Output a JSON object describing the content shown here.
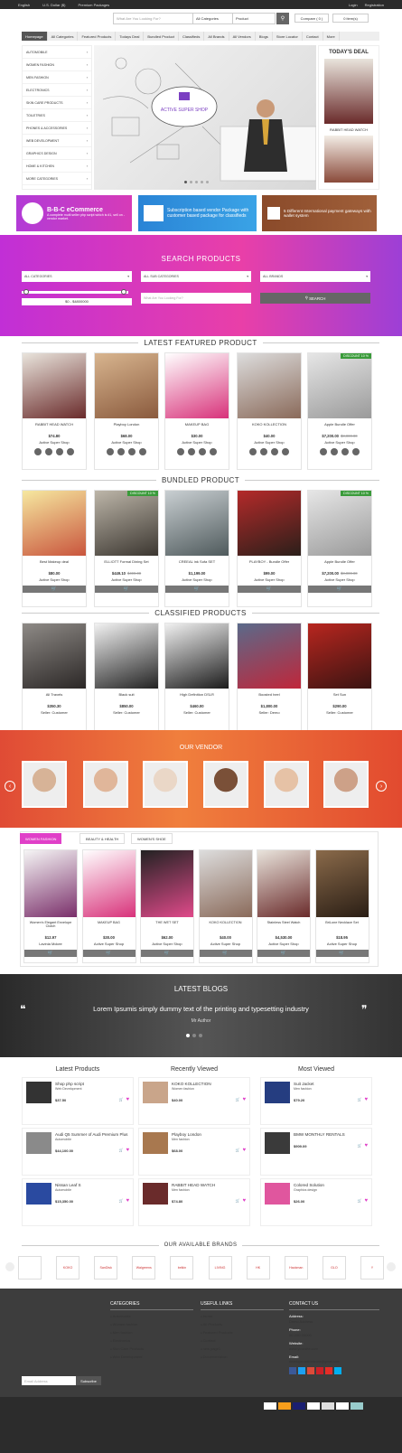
{
  "topbar": {
    "lang": "English",
    "currency": "U.S. Dollar ($)",
    "premium": "Premium Packages",
    "login": "Login",
    "register": "Registration"
  },
  "search": {
    "placeholder": "What Are You Looking For?",
    "category": "All Categories",
    "type": "Product",
    "compare": "Compare ( 0 )",
    "cart": "0 item(s)"
  },
  "nav": [
    "Homepage",
    "All Categories",
    "Featured Products",
    "Todays Deal",
    "Bundled Product",
    "Classifieds",
    "All Brands",
    "All Vendors",
    "Blogs",
    "Store Locator",
    "Contact",
    "More"
  ],
  "categories": [
    "AUTOMOBILE",
    "WOMEN FASHION",
    "MEN FASHION",
    "ELECTRONICS",
    "SKIN CARE PRODUCTS",
    "TOILETRIES",
    "PHONES & ACCESSORIES",
    "WEB DEVELOPMENT",
    "GRAPHICS DESIGN",
    "HOME & KITCHEN",
    "MORE CATEGORIES"
  ],
  "hero": {
    "sign": "ACTIVE SUPER SHOP"
  },
  "today": {
    "title": "TODAY'S DEAL",
    "item": "RABBIT HEAD WATCH"
  },
  "banners": {
    "b1title": "B-B-C eCommerce",
    "b1text": "A complete multi seller php script which is #1, sell on - vendor market.",
    "b2text": "Subscription based vendor Package with customer based package for classifieds",
    "b3text": "5 Different International payment gateways with wallet system"
  },
  "searchproducts": {
    "title": "SEARCH PRODUCTS",
    "cat": "ALL CATEGORIES",
    "sub": "ALL SUB CATEGORIES",
    "brand": "ALL BRANDS",
    "range": "$0 - $4800000",
    "placeholder": "What Are You Looking For?",
    "btn": "SEARCH"
  },
  "featured": {
    "title": "LATEST FEATURED PRODUCT",
    "items": [
      {
        "name": "RABBIT HEAD WATCH",
        "price": "$74.80",
        "old": "",
        "shop": "Active Super Shop",
        "disc": "",
        "c1": "#e9e4dc",
        "c2": "#6a2b2b"
      },
      {
        "name": "Playboy London",
        "price": "$68.00",
        "old": "",
        "shop": "Active Super Shop",
        "disc": "",
        "c1": "#d8b58f",
        "c2": "#8a5a3d"
      },
      {
        "name": "MAKEUP BAG",
        "price": "$30.00",
        "old": "",
        "shop": "Active Super Shop",
        "disc": "",
        "c1": "#fff",
        "c2": "#d8327a"
      },
      {
        "name": "KOKO KOLLECTION",
        "price": "$40.00",
        "old": "",
        "shop": "Active Super Shop",
        "disc": "",
        "c1": "#ddd",
        "c2": "#8a6a5a"
      },
      {
        "name": "Apple Bundle Offer",
        "price": "$7,200.00",
        "old": "$8,000.00",
        "shop": "Active Super Shop",
        "disc": "DISCOUNT 10 %",
        "c1": "#e6e6e6",
        "c2": "#9a9a9a"
      }
    ]
  },
  "bundled": {
    "title": "BUNDLED PRODUCT",
    "items": [
      {
        "name": "Best Makeup deal",
        "price": "$80.00",
        "old": "",
        "shop": "Active Super Shop",
        "disc": "",
        "c1": "#f6e8a0",
        "c2": "#c9553d"
      },
      {
        "name": "ELLIOTT Formal Dining Set",
        "price": "$449.10",
        "old": "$499.00",
        "shop": "Active Super Shop",
        "disc": "DISCOUNT 10 %",
        "c1": "#bdb6a9",
        "c2": "#3b3630"
      },
      {
        "name": "CREEAL ink Sofa SET",
        "price": "$1,199.00",
        "old": "",
        "shop": "Active Super Shop",
        "disc": "",
        "c1": "#c9cfd2",
        "c2": "#4f5a5c"
      },
      {
        "name": "PLAYBOY - Bundle Offer",
        "price": "$99.00",
        "old": "",
        "shop": "Active Super Shop",
        "disc": "",
        "c1": "#b42a2a",
        "c2": "#2b1f1a"
      },
      {
        "name": "Apple Bundle Offer",
        "price": "$7,200.00",
        "old": "$8,000.00",
        "shop": "Active Super Shop",
        "disc": "DISCOUNT 10 %",
        "c1": "#e6e6e6",
        "c2": "#9a9a9a"
      }
    ]
  },
  "classified": {
    "title": "CLASSIFIED PRODUCTS",
    "items": [
      {
        "name": "All Travels",
        "price": "$350.30",
        "shop": "Seller: Customer",
        "c1": "#8e8a86",
        "c2": "#2b2726"
      },
      {
        "name": "Black suit",
        "price": "$850.00",
        "shop": "Seller: Customer",
        "c1": "#f2f2f2",
        "c2": "#222"
      },
      {
        "name": "High Definition DSLR",
        "price": "$460.00",
        "shop": "Seller: Customer",
        "c1": "#f1f1f1",
        "c2": "#1b1b1b"
      },
      {
        "name": "Boosted heel",
        "price": "$1,800.00",
        "shop": "Seller: Demo",
        "c1": "#5a6a8a",
        "c2": "#c0263a"
      },
      {
        "name": "Set Sun",
        "price": "$290.00",
        "shop": "Seller: Customer",
        "c1": "#b8261f",
        "c2": "#3a1412"
      }
    ]
  },
  "vendor": {
    "title": "OUR VENDOR",
    "faces": [
      "#d7b397",
      "#e0b69a",
      "#ead7c7",
      "#7a5038",
      "#e6c2a6",
      "#cda188"
    ]
  },
  "tabs": {
    "labels": [
      "WOMEN FASHION",
      "BEAUTY & HEALTH",
      "WOMEN'S SHOE"
    ],
    "items": [
      {
        "name": "Women's Elegant Envelope Clutch",
        "price": "$12.97",
        "shop": "Lavinia Mckee",
        "c1": "#f5f5f5",
        "c2": "#7a2f6a"
      },
      {
        "name": "MAKEUP BAG",
        "price": "$30.00",
        "shop": "Active Super Shop",
        "c1": "#fff",
        "c2": "#d8327a"
      },
      {
        "name": "THE WET SET",
        "price": "$62.00",
        "shop": "Active Super Shop",
        "c1": "#222",
        "c2": "#e04a8a"
      },
      {
        "name": "KOKO KOLLECTION",
        "price": "$40.00",
        "shop": "Active Super Shop",
        "c1": "#ddd",
        "c2": "#8a6a5a"
      },
      {
        "name": "Stainless Steel Watch",
        "price": "$4,530.00",
        "shop": "Active Super Shop",
        "c1": "#e9e4dc",
        "c2": "#6a2b2b"
      },
      {
        "name": "BriLone Necklace Set",
        "price": "$18.95",
        "shop": "Active Super Shop",
        "c1": "#8a6a4a",
        "c2": "#2a1e15"
      }
    ]
  },
  "blogs": {
    "title": "LATEST BLOGS",
    "text": "Lorem Ipsumis simply dummy text of the printing and typesetting industry",
    "author": "Mr Author"
  },
  "lists": [
    {
      "title": "Latest Products",
      "items": [
        {
          "name": "Shop php script",
          "cat": "Web Development",
          "price": "$37.50",
          "c": "#333"
        },
        {
          "name": "Audi Q5 Summer of Audi Premium Plus",
          "cat": "Automobile",
          "price": "$44,100.00",
          "c": "#8a8a8a"
        },
        {
          "name": "Nissan Leaf S",
          "cat": "Automobile",
          "price": "$15,350.00",
          "c": "#2a4aa0"
        }
      ]
    },
    {
      "title": "Recently Viewed",
      "items": [
        {
          "name": "KOKO KOLLECTION",
          "cat": "Women fashion",
          "price": "$40.00",
          "c": "#c9a58a"
        },
        {
          "name": "Playboy London",
          "cat": "Men fashion",
          "price": "$68.00",
          "c": "#a8784f"
        },
        {
          "name": "RABBIT HEAD WATCH",
          "cat": "Men fashion",
          "price": "$74.80",
          "c": "#6a2b2b"
        }
      ]
    },
    {
      "title": "Most Viewed",
      "items": [
        {
          "name": "Suit Jacket",
          "cat": "Men fashion",
          "price": "$79.20",
          "c": "#253d80"
        },
        {
          "name": "BMW MONTHLY RENTALS",
          "cat": "",
          "price": "$909.09",
          "c": "#3a3a3a"
        },
        {
          "name": "Colored Solution",
          "cat": "Graphics design",
          "price": "$26.00",
          "c": "#e0569e"
        }
      ]
    }
  ],
  "brands": {
    "title": "OUR AVAILABLE BRANDS",
    "items": [
      "",
      "KOKO",
      "SanDisk",
      "Walgreens",
      "belkin",
      "LIVING",
      "HK",
      "Hackman",
      "GLO",
      "Y"
    ]
  },
  "footer": {
    "catTitle": "CATEGORIES",
    "cats": [
      "Automobile",
      "Women fashion",
      "Men fashion",
      "Electronics",
      "Skin Care Products",
      "Web Development"
    ],
    "linkTitle": "USEFUL LINKS",
    "links": [
      "Home",
      "All Products",
      "Featured Products",
      "Contact",
      "new page1",
      "Documentation"
    ],
    "contactTitle": "CONTACT US",
    "addrL": "Address:",
    "addr": "Demo Address",
    "phoneL": "Phone:",
    "phone": "00-000-00000",
    "webL": "Website:",
    "web": "www.yoursite.com",
    "emailL": "Email:",
    "email": "developer.activeitzone@gmail.com",
    "emailPh": "Email Address",
    "subscribe": "Subscribe"
  }
}
